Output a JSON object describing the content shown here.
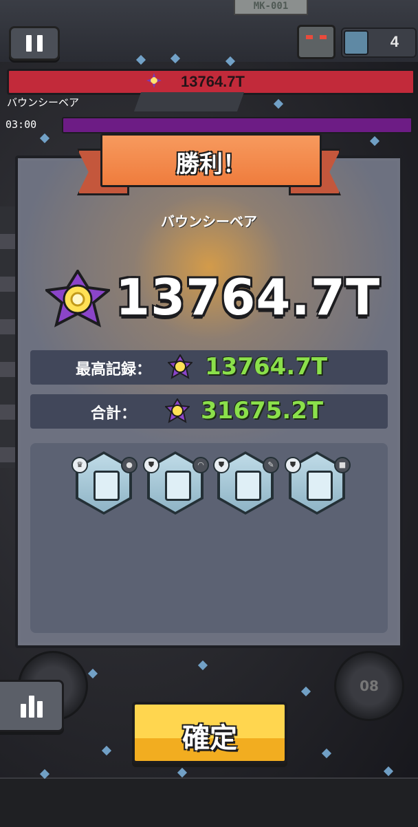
{
  "hud": {
    "sign_text": "MK-001",
    "wave_count": "4",
    "boss_hp": "13764.7T",
    "boss_name": "バウンシーベア",
    "timer": "03:00"
  },
  "result": {
    "title": "勝利！",
    "enemy_name": "バウンシーベア",
    "score": "13764.7T",
    "best_label": "最高記録：",
    "best_value": "13764.7T",
    "total_label": "合計：",
    "total_value": "31675.2T"
  },
  "rewards": [
    {
      "icon": "armor-icon",
      "tier_icon": "crown-icon",
      "type_icon": "bomb-icon"
    },
    {
      "icon": "camera-icon",
      "tier_icon": "shield-icon",
      "type_icon": "arc-icon"
    },
    {
      "icon": "crystal-icon",
      "tier_icon": "shield-icon",
      "type_icon": "feather-icon"
    },
    {
      "icon": "boots-icon",
      "tier_icon": "shield-icon",
      "type_icon": "block-icon"
    }
  ],
  "controls": {
    "confirm_label": "確定",
    "stats_button_icon": "bar-chart-icon",
    "skill_slot_label": "08"
  },
  "colors": {
    "hp_bar": "#c22a3a",
    "timer_bar": "#6d1c85",
    "ribbon": "#ef7c3d",
    "score_green": "#8be04b",
    "confirm": "#ffd64f"
  }
}
